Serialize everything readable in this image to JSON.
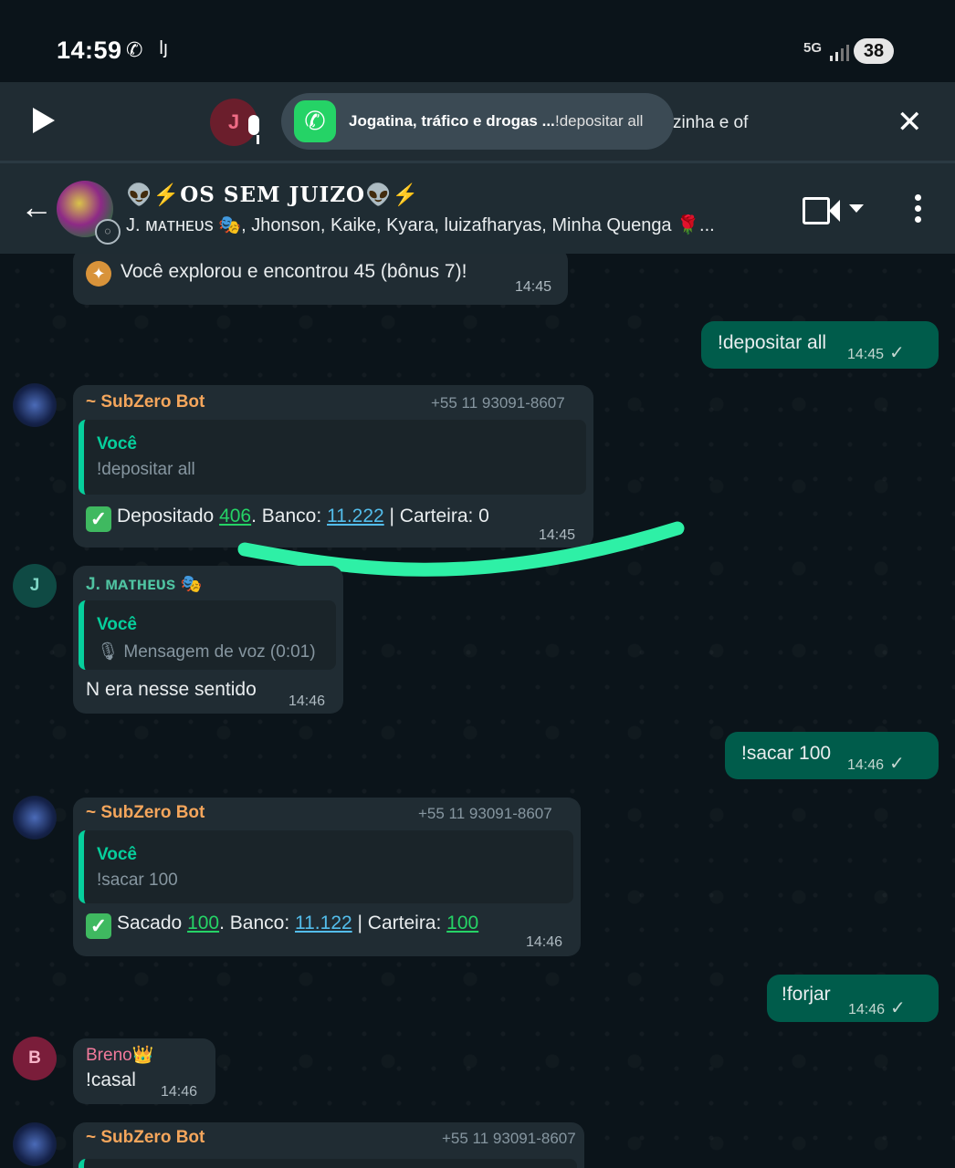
{
  "status_bar": {
    "time": "14:59",
    "network": "5G",
    "battery": "38"
  },
  "media_bar": {
    "avatar_initial": "J",
    "app_title": "Jogatina, tráfico e drogas ...",
    "last_message": "!depositar all",
    "overflow_text": "zinha e of"
  },
  "chat_header": {
    "group_name": "👽⚡OS SEM JUIZO👽⚡",
    "members": "J. ᴍᴀᴛʜᴇᴜs 🎭, Jhonson, Kaike, Kyara, luizafharyas, Minha Quenga 🌹..."
  },
  "messages": {
    "m1": {
      "text": "Você explorou e encontrou 45 (bônus 7)!",
      "time": "14:45",
      "icon": "compass-icon"
    },
    "m2": {
      "text": "!depositar all",
      "time": "14:45"
    },
    "m3": {
      "sender": "~ SubZero Bot",
      "phone": "+55 11 93091-8607",
      "quote_author": "Você",
      "quote_text": "!depositar all",
      "t1": "Depositado ",
      "v1": "406",
      "t2": ". Banco: ",
      "v2": "11.222",
      "t3": " | Carteira: 0",
      "time": "14:45"
    },
    "m4": {
      "sender": "J. ᴍᴀᴛʜᴇᴜs 🎭",
      "avatar_initial": "J",
      "quote_author": "Você",
      "quote_text": "Mensagem de voz (0:01)",
      "text": "N era nesse sentido",
      "time": "14:46"
    },
    "m5": {
      "text": "!sacar 100",
      "time": "14:46"
    },
    "m6": {
      "sender": "~ SubZero Bot",
      "phone": "+55 11 93091-8607",
      "quote_author": "Você",
      "quote_text": "!sacar 100",
      "t1": "Sacado ",
      "v1": "100",
      "t2": ". Banco: ",
      "v2": "11.122",
      "t3": " | Carteira: ",
      "v3": "100",
      "time": "14:46"
    },
    "m7": {
      "text": "!forjar",
      "time": "14:46"
    },
    "m8": {
      "sender": "Breno👑",
      "avatar_initial": "B",
      "text": "!casal",
      "time": "14:46"
    },
    "m9": {
      "sender": "~ SubZero Bot",
      "phone": "+55 11 93091-8607"
    }
  },
  "colors": {
    "background": "#0b141a",
    "incoming": "#202c33",
    "outgoing": "#005c4b",
    "accent": "#06cf9c",
    "annotation_stroke": "#2ef0a6"
  }
}
